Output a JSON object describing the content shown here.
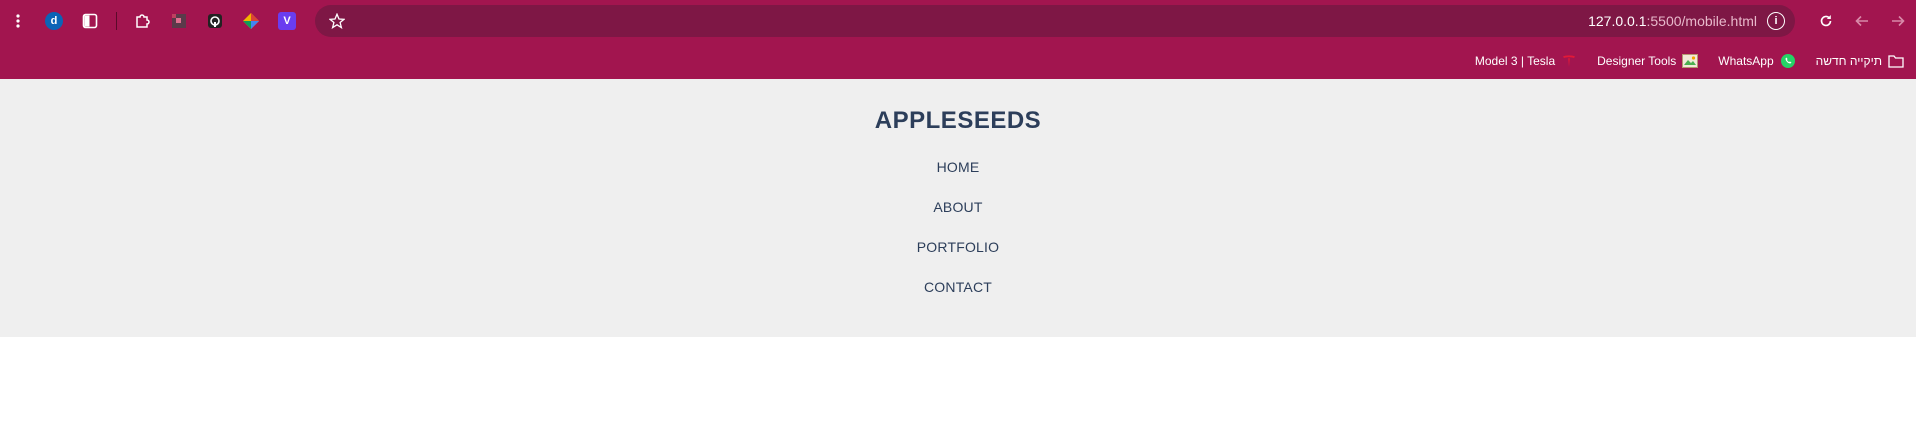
{
  "browser": {
    "url_host": "127.0.0.1",
    "url_rest": ":5500/mobile.html",
    "extensions": [
      {
        "name": "d",
        "color": "#0b63b6"
      },
      {
        "name": "",
        "color": "#ffffff"
      },
      {
        "name": "V",
        "color": "#6a3df0"
      }
    ],
    "bookmarks": [
      {
        "label": "תיקייה חדשה",
        "icon": "folder-icon"
      },
      {
        "label": "WhatsApp",
        "icon": "whatsapp-icon"
      },
      {
        "label": "Designer Tools",
        "icon": "designer-tools-icon"
      },
      {
        "label": "Model 3 | Tesla",
        "icon": "tesla-icon"
      }
    ]
  },
  "page": {
    "title": "APPLESEEDS",
    "nav": [
      "HOME",
      "ABOUT",
      "PORTFOLIO",
      "CONTACT"
    ]
  },
  "colors": {
    "chrome": "#a2154f",
    "omnibox": "#7e1745",
    "header_bg": "#efefef",
    "title": "#2c3e5a"
  }
}
